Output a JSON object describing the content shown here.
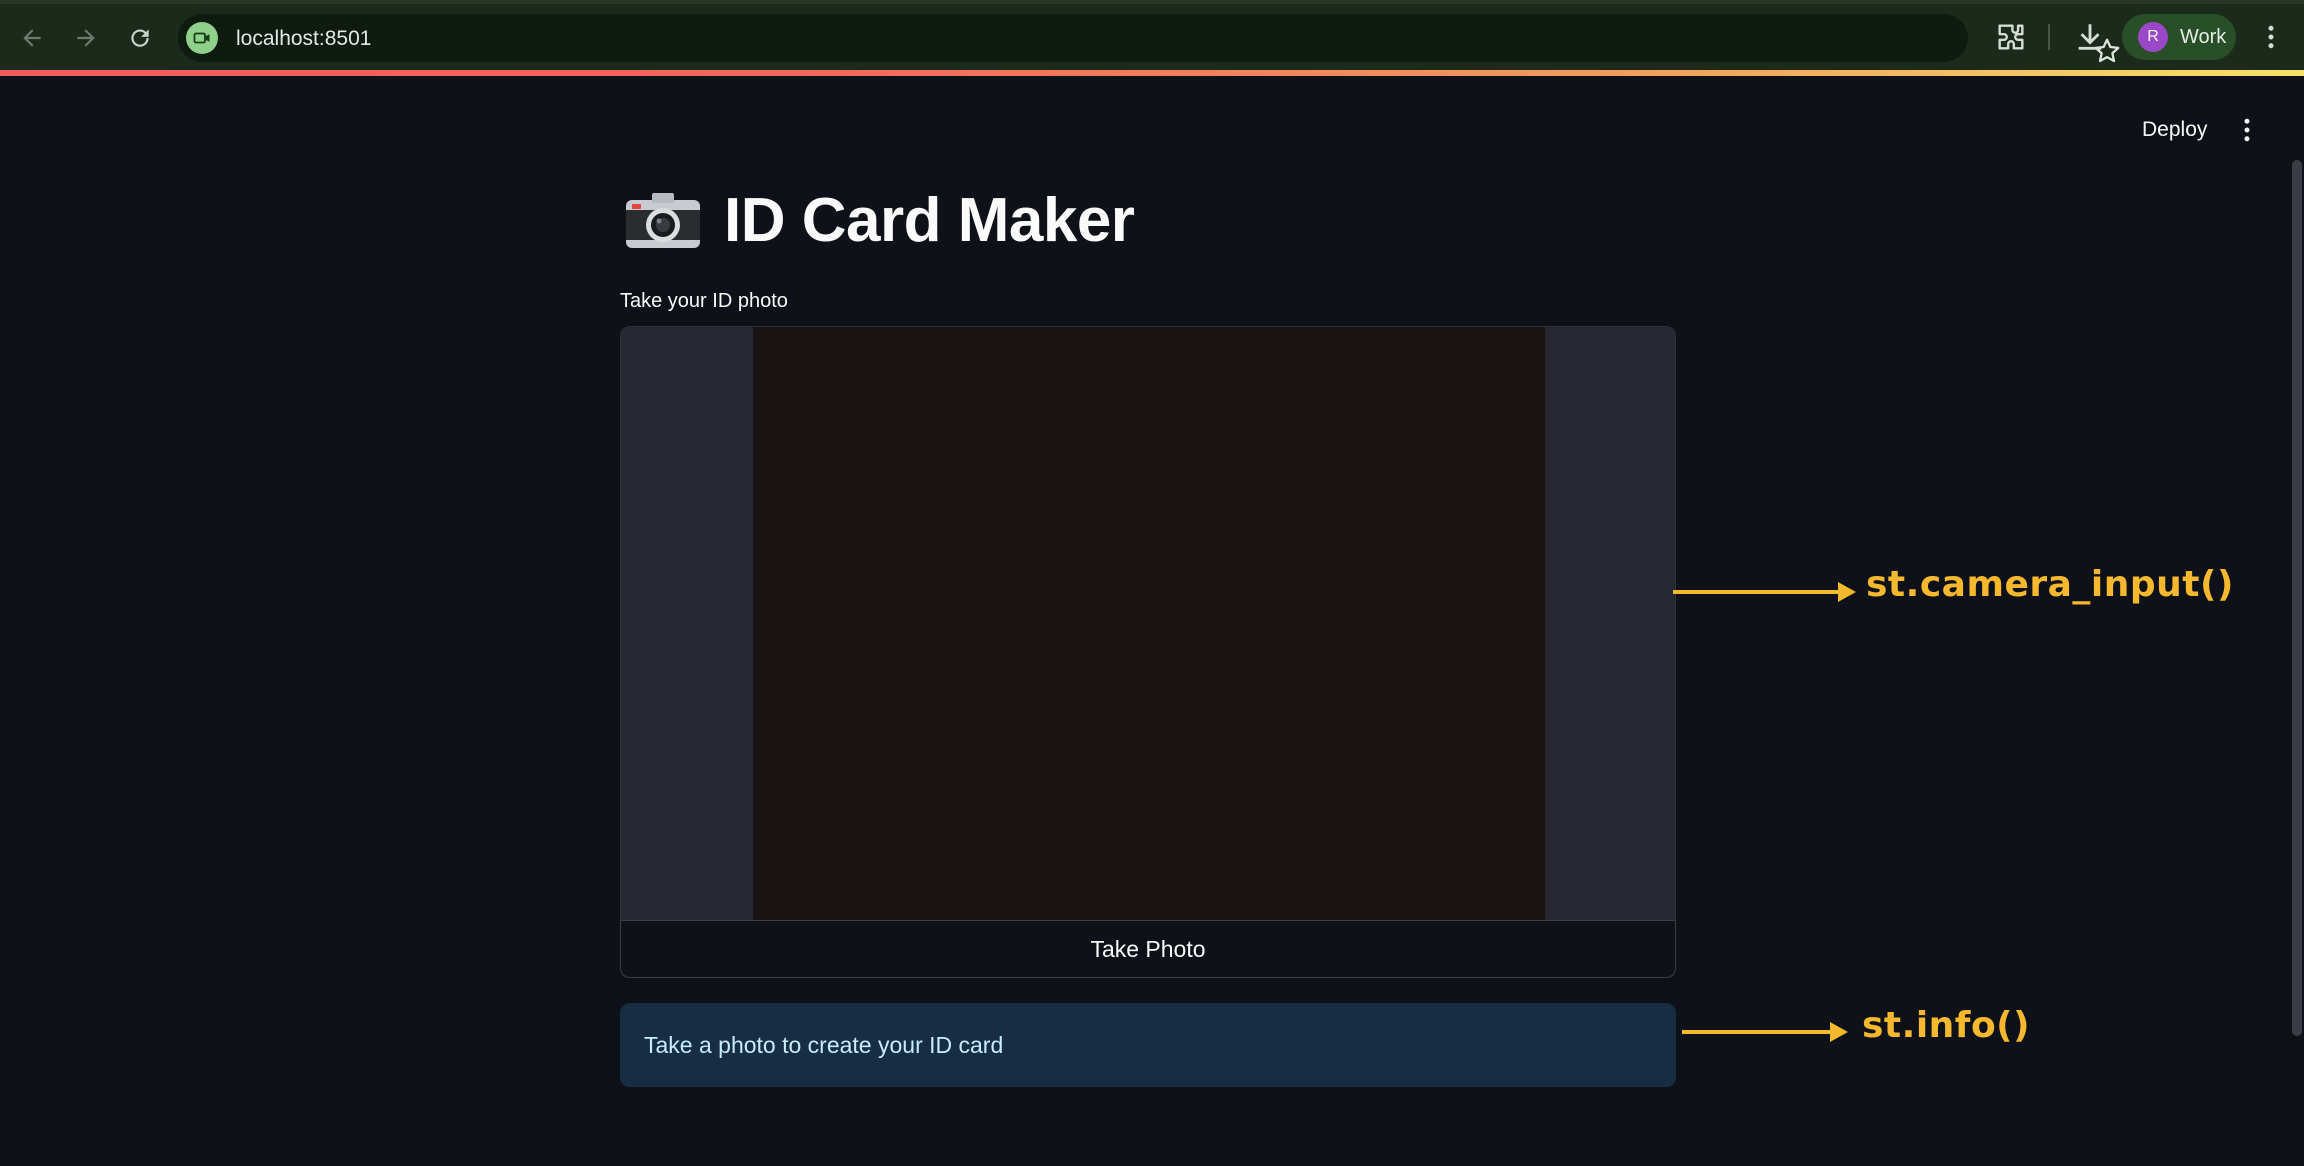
{
  "browser": {
    "url": "localhost:8501",
    "profile_initial": "R",
    "profile_name": "Work",
    "icons": [
      "back-arrow-icon",
      "forward-arrow-icon",
      "reload-icon",
      "camera-site-icon",
      "star-icon",
      "extensions-icon",
      "download-icon",
      "kebab-menu-icon"
    ]
  },
  "app": {
    "deploy_label": "Deploy",
    "title": "ID Card Maker",
    "title_icon": "camera-emoji",
    "camera_label": "Take your ID photo",
    "take_photo_label": "Take Photo",
    "info_text": "Take a photo to create your ID card"
  },
  "annotations": {
    "camera": "st.camera_input()",
    "info": "st.info()"
  },
  "colors": {
    "background": "#0e1117",
    "info_bg": "#172d43",
    "info_text": "#c7ebff",
    "annotation": "#f5b82e",
    "chrome": "#1c2a1c"
  }
}
